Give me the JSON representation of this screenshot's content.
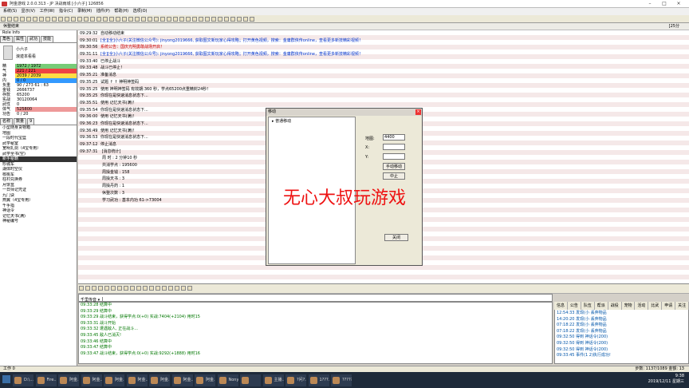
{
  "window": {
    "title": "阿金游戏 2.0.0.313 - JP 决战雨城 [小六子] 126856",
    "close": "×",
    "min": "–",
    "max": "□"
  },
  "menu": [
    "系统(S)",
    "显示(V)",
    "工作(W)",
    "指令(C)",
    "录制(M)",
    "插件(P)",
    "帮助(H)",
    "选项(O)"
  ],
  "strip": {
    "left": "休整结束",
    "right": "[25分"
  },
  "left": {
    "role_info": "Role Info",
    "tabs": [
      "角色",
      "属性",
      "武功",
      "技能"
    ],
    "name": "小六子",
    "title": "浪迹本看看",
    "stats": [
      {
        "k": "精",
        "v": "1972 / 1972",
        "c": "#7c7"
      },
      {
        "k": "气",
        "v": "221 / 221",
        "c": "#e44"
      },
      {
        "k": "神",
        "v": "2039 / 2039",
        "c": "#fd4"
      },
      {
        "k": "内",
        "v": "0 / 0",
        "c": "#39f"
      },
      {
        "k": "负重",
        "v": "90 / 273   61 : 63",
        "c": ""
      },
      {
        "k": "金钱",
        "v": "2666737",
        "c": ""
      },
      {
        "k": "存款",
        "v": "65200",
        "c": ""
      },
      {
        "k": "实战",
        "v": "30120064",
        "c": ""
      },
      {
        "k": "武性",
        "v": "0",
        "c": ""
      },
      {
        "k": "体气",
        "v": "525800",
        "c": "#e99"
      },
      {
        "k": "功告",
        "v": "0 / 20",
        "c": ""
      }
    ],
    "inv_header": [
      "名称",
      "数量",
      "9"
    ],
    "inv": [
      "小型随身货物箱",
      "地图",
      "一段时代宝篮",
      "武学秘室",
      "宽明扎剑（4宝专用）",
      "武学全书(空)",
      "新手秘籍",
      "珍城车",
      "湖体时空仪",
      "核桃车",
      "枉村兑换券",
      "月饼盒",
      "一日师记凭证",
      "九门诀",
      "燕翼（4宝专用）",
      "千手指",
      "神话令",
      "记忆天书(满)",
      "神秘编号"
    ]
  },
  "log": [
    {
      "t": "09:29:32",
      "m": "自动移动结束",
      "c": ""
    },
    {
      "t": "09:30:01",
      "m": "[全][全]小六子(关注微信公众号): jinyong2019666, 获取图文新玩家心得攻略；打开黄色视频，搜索：金庸群侠传online，查看更多新技精彩视频！",
      "c": "blue"
    },
    {
      "t": "09:30:56",
      "m": "系统公告：国庆光明勇敢战场开启！",
      "c": "red"
    },
    {
      "t": "09:31:11",
      "m": "[全][全]小六子(关注微信公众号): jinyong2019666, 获取图文新玩家心得攻略；打开黄色视频，搜索：金庸群侠传online，查看更多新技精彩视频！",
      "c": "blue"
    },
    {
      "t": "09:33:40",
      "m": "已停止战斗",
      "c": ""
    },
    {
      "t": "09:33:48",
      "m": "战斗已停止！",
      "c": ""
    },
    {
      "t": "09:35:21",
      "m": "准备消息",
      "c": ""
    },
    {
      "t": "09:35:25",
      "m": "试题 ↑ ↑  神明神签码",
      "c": ""
    },
    {
      "t": "09:35:25",
      "m": "使用 神明神签码 有效期:360 秒，学点65200点重精封24秒！",
      "c": ""
    },
    {
      "t": "09:35:25",
      "m": "你现在是快速消息状态下...",
      "c": ""
    },
    {
      "t": "09:35:51",
      "m": "使用 记忆天书(满)！",
      "c": ""
    },
    {
      "t": "09:35:54",
      "m": "你现在是快速消息状态下...",
      "c": ""
    },
    {
      "t": "09:36:00",
      "m": "使用 记忆天书(满)！",
      "c": ""
    },
    {
      "t": "09:36:23",
      "m": "你现在是快速消息状态下...",
      "c": ""
    },
    {
      "t": "09:36:49",
      "m": "使用 记忆天书(满)！",
      "c": ""
    },
    {
      "t": "09:36:53",
      "m": "你现在是快速消息状态下...",
      "c": ""
    },
    {
      "t": "09:37:12",
      "m": "停止消息",
      "c": ""
    },
    {
      "t": "09:37:31",
      "m": "               [消息统计]",
      "c": ""
    },
    {
      "t": "",
      "m": "周   时 : 2 分钟10 秒",
      "c": ""
    },
    {
      "t": "",
      "m": "共消学点 : 195600",
      "c": ""
    },
    {
      "t": "",
      "m": "周操金钱 : 158",
      "c": ""
    },
    {
      "t": "",
      "m": "周操天书 : 3",
      "c": ""
    },
    {
      "t": "",
      "m": "周操丹药 : 1",
      "c": ""
    },
    {
      "t": "",
      "m": "休整次数 : 3",
      "c": ""
    },
    {
      "t": "",
      "m": "学习武功 : 基本内功 61->73004",
      "c": ""
    }
  ],
  "dialog": {
    "title": "移动",
    "close": "×",
    "item": "普通移动",
    "map_label": "地图:",
    "map_value": "4400",
    "x_label": "X:",
    "y_label": "Y:",
    "manual": "手动移动",
    "stop": "中止",
    "close_btn": "关闭"
  },
  "watermark": "无心大叔玩游戏",
  "chat": {
    "channel": "千里传音 ▾",
    "lines": [
      "09:33:28 结算中",
      "09:33:29 结算中",
      "09:33:29 战斗结束，获得学点:0(+0) 实战:7404(+2104) 用时15",
      "09:33:31 战斗开始",
      "09:33:32 遭遇敌人, 正在战斗...",
      "09:33:45 敌人已消灭!",
      "09:33:46 结算中",
      "09:33:47 结算中",
      "09:33:47 战斗结束，获得学点:0(+0) 实战:9292(+1888) 用时16"
    ]
  },
  "sys": {
    "tabs": [
      "信息",
      "公告",
      "队伍",
      "帮派",
      "战役",
      "宠物",
      "活动",
      "比武",
      "申请",
      "关注"
    ],
    "lines": [
      "12:54:33 发现(小 丢弃物品",
      "14:20:20 发现(小 丢弃物品",
      "07:18:22 发现(小 丢弃物品",
      "07:18:22 发现(小 丢弃物品",
      "09:32:50 得到 神话令(200)",
      "09:32:50 得到 神话令(200)",
      "09:32:50 得到 神话令(200)",
      "09:33:45 事件(1 2)执行成功!"
    ]
  },
  "statusbar": {
    "left": "工作 0",
    "right": "步数: 1137/1089  金额: 13"
  },
  "taskbar": [
    "D:\\...",
    "Fire...",
    "阿金...",
    "阿金...",
    "阿金...",
    "阿金...",
    "阿金...",
    "阿金...",
    "阿金...",
    "Nony...",
    "",
    "主播...",
    "?问?...",
    "1???...",
    "?????..."
  ],
  "clock": {
    "time": "9:38",
    "date": "2019/12/11 星期三"
  }
}
